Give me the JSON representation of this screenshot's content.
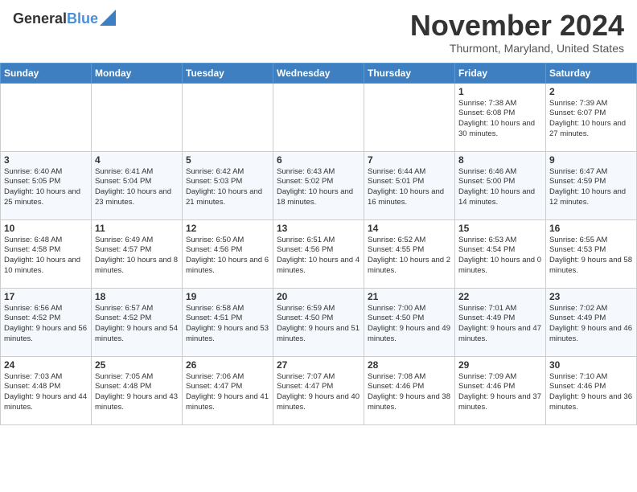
{
  "header": {
    "logo_line1": "General",
    "logo_line2": "Blue",
    "month_title": "November 2024",
    "location": "Thurmont, Maryland, United States"
  },
  "weekdays": [
    "Sunday",
    "Monday",
    "Tuesday",
    "Wednesday",
    "Thursday",
    "Friday",
    "Saturday"
  ],
  "weeks": [
    [
      {
        "day": "",
        "sunrise": "",
        "sunset": "",
        "daylight": ""
      },
      {
        "day": "",
        "sunrise": "",
        "sunset": "",
        "daylight": ""
      },
      {
        "day": "",
        "sunrise": "",
        "sunset": "",
        "daylight": ""
      },
      {
        "day": "",
        "sunrise": "",
        "sunset": "",
        "daylight": ""
      },
      {
        "day": "",
        "sunrise": "",
        "sunset": "",
        "daylight": ""
      },
      {
        "day": "1",
        "sunrise": "Sunrise: 7:38 AM",
        "sunset": "Sunset: 6:08 PM",
        "daylight": "Daylight: 10 hours and 30 minutes."
      },
      {
        "day": "2",
        "sunrise": "Sunrise: 7:39 AM",
        "sunset": "Sunset: 6:07 PM",
        "daylight": "Daylight: 10 hours and 27 minutes."
      }
    ],
    [
      {
        "day": "3",
        "sunrise": "Sunrise: 6:40 AM",
        "sunset": "Sunset: 5:05 PM",
        "daylight": "Daylight: 10 hours and 25 minutes."
      },
      {
        "day": "4",
        "sunrise": "Sunrise: 6:41 AM",
        "sunset": "Sunset: 5:04 PM",
        "daylight": "Daylight: 10 hours and 23 minutes."
      },
      {
        "day": "5",
        "sunrise": "Sunrise: 6:42 AM",
        "sunset": "Sunset: 5:03 PM",
        "daylight": "Daylight: 10 hours and 21 minutes."
      },
      {
        "day": "6",
        "sunrise": "Sunrise: 6:43 AM",
        "sunset": "Sunset: 5:02 PM",
        "daylight": "Daylight: 10 hours and 18 minutes."
      },
      {
        "day": "7",
        "sunrise": "Sunrise: 6:44 AM",
        "sunset": "Sunset: 5:01 PM",
        "daylight": "Daylight: 10 hours and 16 minutes."
      },
      {
        "day": "8",
        "sunrise": "Sunrise: 6:46 AM",
        "sunset": "Sunset: 5:00 PM",
        "daylight": "Daylight: 10 hours and 14 minutes."
      },
      {
        "day": "9",
        "sunrise": "Sunrise: 6:47 AM",
        "sunset": "Sunset: 4:59 PM",
        "daylight": "Daylight: 10 hours and 12 minutes."
      }
    ],
    [
      {
        "day": "10",
        "sunrise": "Sunrise: 6:48 AM",
        "sunset": "Sunset: 4:58 PM",
        "daylight": "Daylight: 10 hours and 10 minutes."
      },
      {
        "day": "11",
        "sunrise": "Sunrise: 6:49 AM",
        "sunset": "Sunset: 4:57 PM",
        "daylight": "Daylight: 10 hours and 8 minutes."
      },
      {
        "day": "12",
        "sunrise": "Sunrise: 6:50 AM",
        "sunset": "Sunset: 4:56 PM",
        "daylight": "Daylight: 10 hours and 6 minutes."
      },
      {
        "day": "13",
        "sunrise": "Sunrise: 6:51 AM",
        "sunset": "Sunset: 4:56 PM",
        "daylight": "Daylight: 10 hours and 4 minutes."
      },
      {
        "day": "14",
        "sunrise": "Sunrise: 6:52 AM",
        "sunset": "Sunset: 4:55 PM",
        "daylight": "Daylight: 10 hours and 2 minutes."
      },
      {
        "day": "15",
        "sunrise": "Sunrise: 6:53 AM",
        "sunset": "Sunset: 4:54 PM",
        "daylight": "Daylight: 10 hours and 0 minutes."
      },
      {
        "day": "16",
        "sunrise": "Sunrise: 6:55 AM",
        "sunset": "Sunset: 4:53 PM",
        "daylight": "Daylight: 9 hours and 58 minutes."
      }
    ],
    [
      {
        "day": "17",
        "sunrise": "Sunrise: 6:56 AM",
        "sunset": "Sunset: 4:52 PM",
        "daylight": "Daylight: 9 hours and 56 minutes."
      },
      {
        "day": "18",
        "sunrise": "Sunrise: 6:57 AM",
        "sunset": "Sunset: 4:52 PM",
        "daylight": "Daylight: 9 hours and 54 minutes."
      },
      {
        "day": "19",
        "sunrise": "Sunrise: 6:58 AM",
        "sunset": "Sunset: 4:51 PM",
        "daylight": "Daylight: 9 hours and 53 minutes."
      },
      {
        "day": "20",
        "sunrise": "Sunrise: 6:59 AM",
        "sunset": "Sunset: 4:50 PM",
        "daylight": "Daylight: 9 hours and 51 minutes."
      },
      {
        "day": "21",
        "sunrise": "Sunrise: 7:00 AM",
        "sunset": "Sunset: 4:50 PM",
        "daylight": "Daylight: 9 hours and 49 minutes."
      },
      {
        "day": "22",
        "sunrise": "Sunrise: 7:01 AM",
        "sunset": "Sunset: 4:49 PM",
        "daylight": "Daylight: 9 hours and 47 minutes."
      },
      {
        "day": "23",
        "sunrise": "Sunrise: 7:02 AM",
        "sunset": "Sunset: 4:49 PM",
        "daylight": "Daylight: 9 hours and 46 minutes."
      }
    ],
    [
      {
        "day": "24",
        "sunrise": "Sunrise: 7:03 AM",
        "sunset": "Sunset: 4:48 PM",
        "daylight": "Daylight: 9 hours and 44 minutes."
      },
      {
        "day": "25",
        "sunrise": "Sunrise: 7:05 AM",
        "sunset": "Sunset: 4:48 PM",
        "daylight": "Daylight: 9 hours and 43 minutes."
      },
      {
        "day": "26",
        "sunrise": "Sunrise: 7:06 AM",
        "sunset": "Sunset: 4:47 PM",
        "daylight": "Daylight: 9 hours and 41 minutes."
      },
      {
        "day": "27",
        "sunrise": "Sunrise: 7:07 AM",
        "sunset": "Sunset: 4:47 PM",
        "daylight": "Daylight: 9 hours and 40 minutes."
      },
      {
        "day": "28",
        "sunrise": "Sunrise: 7:08 AM",
        "sunset": "Sunset: 4:46 PM",
        "daylight": "Daylight: 9 hours and 38 minutes."
      },
      {
        "day": "29",
        "sunrise": "Sunrise: 7:09 AM",
        "sunset": "Sunset: 4:46 PM",
        "daylight": "Daylight: 9 hours and 37 minutes."
      },
      {
        "day": "30",
        "sunrise": "Sunrise: 7:10 AM",
        "sunset": "Sunset: 4:46 PM",
        "daylight": "Daylight: 9 hours and 36 minutes."
      }
    ]
  ]
}
